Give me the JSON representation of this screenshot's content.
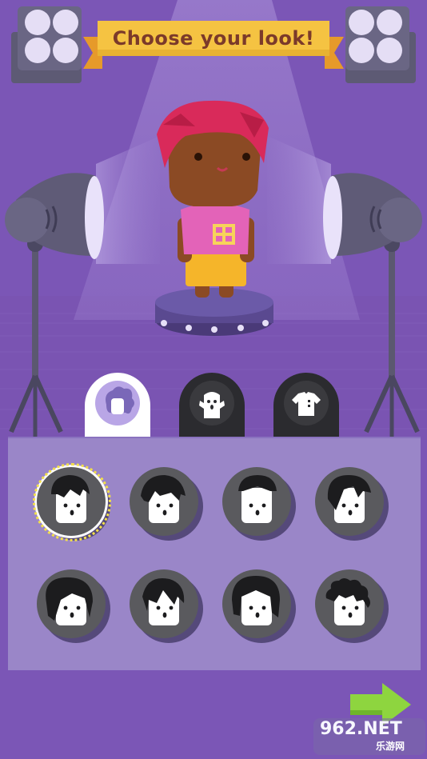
{
  "header": {
    "title": "Choose your look!"
  },
  "colors": {
    "background": "#7a55b5",
    "panel": "#9a86c8",
    "banner": "#f5c342",
    "banner_ribbon": "#e69a2a",
    "title_text": "#7b3a2a",
    "next_arrow": "#8ed53f",
    "selection_ring": "#f3e04a",
    "avatar_hair": "#d92a5a",
    "avatar_skin": "#8b4a24",
    "avatar_shirt": "#e363b8",
    "avatar_skirt": "#f5b52a"
  },
  "tabs": [
    {
      "id": "hair",
      "icon": "hair-style-icon",
      "active": true
    },
    {
      "id": "face",
      "icon": "face-icon",
      "active": false
    },
    {
      "id": "outfit",
      "icon": "shirt-icon",
      "active": false
    }
  ],
  "hair_options": [
    {
      "id": "hair-1",
      "selected": true
    },
    {
      "id": "hair-2",
      "selected": false
    },
    {
      "id": "hair-3",
      "selected": false
    },
    {
      "id": "hair-4",
      "selected": false
    },
    {
      "id": "hair-5",
      "selected": false
    },
    {
      "id": "hair-6",
      "selected": false
    },
    {
      "id": "hair-7",
      "selected": false
    },
    {
      "id": "hair-8",
      "selected": false
    }
  ],
  "navigation": {
    "next_icon": "right-arrow-icon"
  },
  "watermark": {
    "brand": "962.NET",
    "subtitle": "乐游网"
  }
}
